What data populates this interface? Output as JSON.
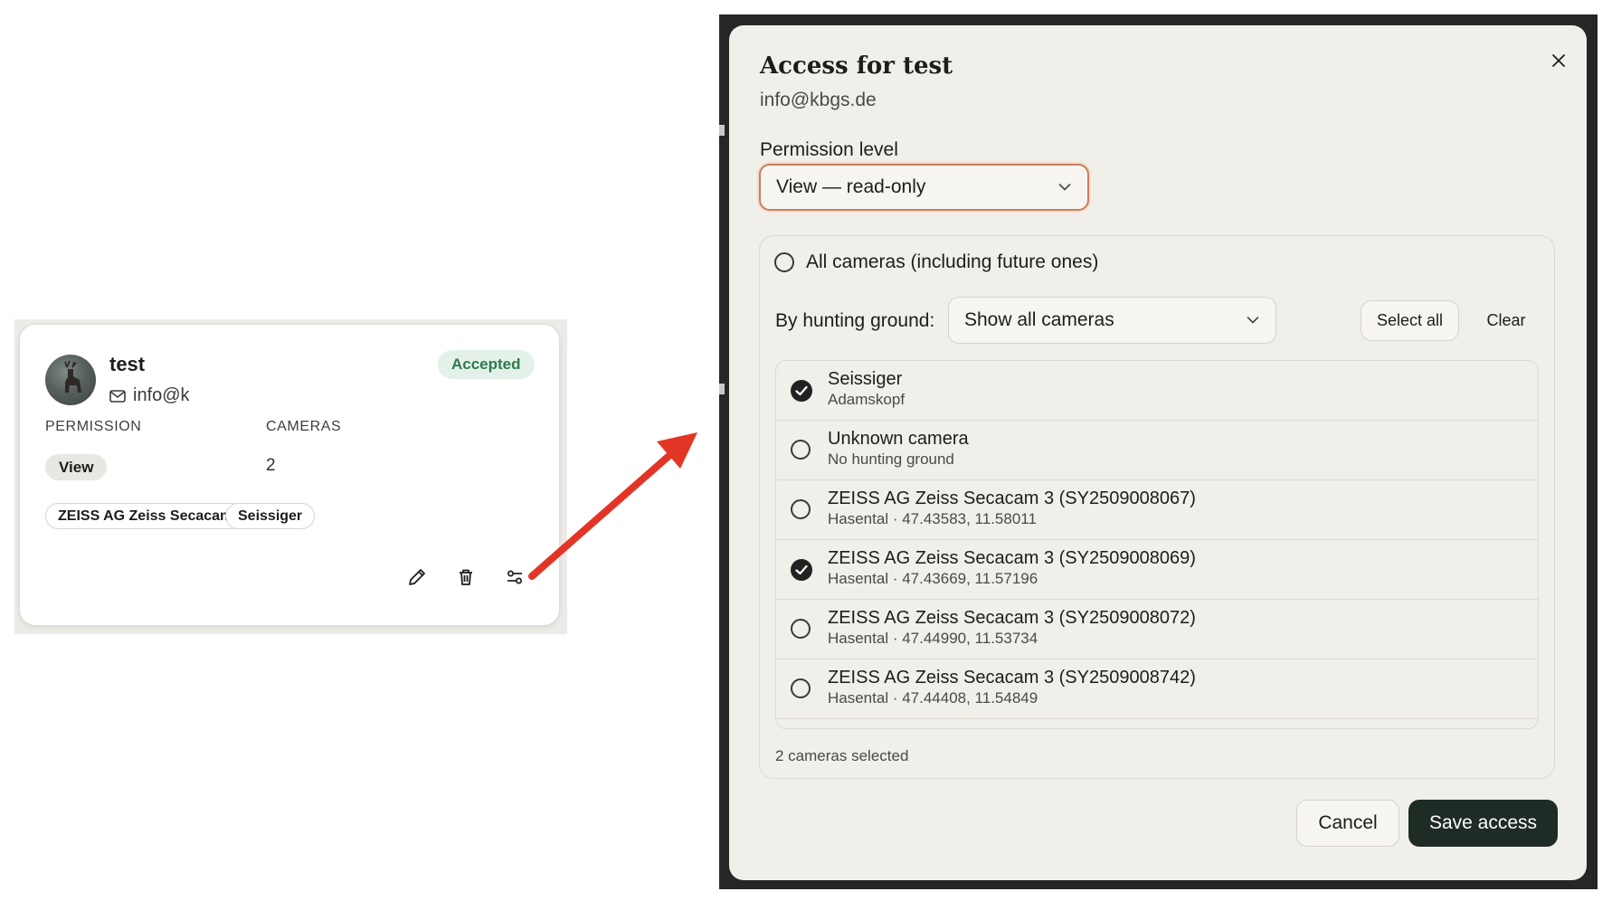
{
  "card": {
    "name": "test",
    "email": "info@kbgs.de",
    "status": "Accepted",
    "permission_label": "PERMISSION",
    "permission_value": "View",
    "cameras_label": "CAMERAS",
    "cameras_count": "2",
    "camera_chips": [
      "ZEISS AG Zeiss Secacam",
      "Seissiger"
    ],
    "actions": [
      "pencil-icon",
      "trash-icon",
      "sliders-icon"
    ]
  },
  "dialog": {
    "title": "Access for test",
    "subtitle": "info@kbgs.de",
    "permission_label": "Permission level",
    "permission_value": "View — read-only",
    "all_cameras_label": "All cameras (including future ones)",
    "all_cameras_checked": false,
    "hunting_ground_label": "By hunting ground:",
    "hunting_ground_value": "Show all cameras",
    "select_all_label": "Select all",
    "clear_label": "Clear",
    "cameras": [
      {
        "name": "Seissiger",
        "detail": "Adamskopf",
        "checked": true
      },
      {
        "name": "Unknown camera",
        "detail": "No hunting ground",
        "checked": false
      },
      {
        "name": "ZEISS AG Zeiss Secacam 3 (SY2509008067)",
        "detail": "Hasental · 47.43583, 11.58011",
        "checked": false
      },
      {
        "name": "ZEISS AG Zeiss Secacam 3 (SY2509008069)",
        "detail": "Hasental · 47.43669, 11.57196",
        "checked": true
      },
      {
        "name": "ZEISS AG Zeiss Secacam 3 (SY2509008072)",
        "detail": "Hasental · 47.44990, 11.53734",
        "checked": false
      },
      {
        "name": "ZEISS AG Zeiss Secacam 3 (SY2509008742)",
        "detail": "Hasental · 47.44408, 11.54849",
        "checked": false
      }
    ],
    "selected_count_text": "2 cameras selected",
    "cancel_label": "Cancel",
    "save_label": "Save access"
  },
  "colors": {
    "accent_border": "#c6805d",
    "primary_button": "#1f2b25",
    "accepted_bg": "#e3f1e8",
    "accepted_text": "#2d7a4b",
    "arrow": "#e33526"
  }
}
